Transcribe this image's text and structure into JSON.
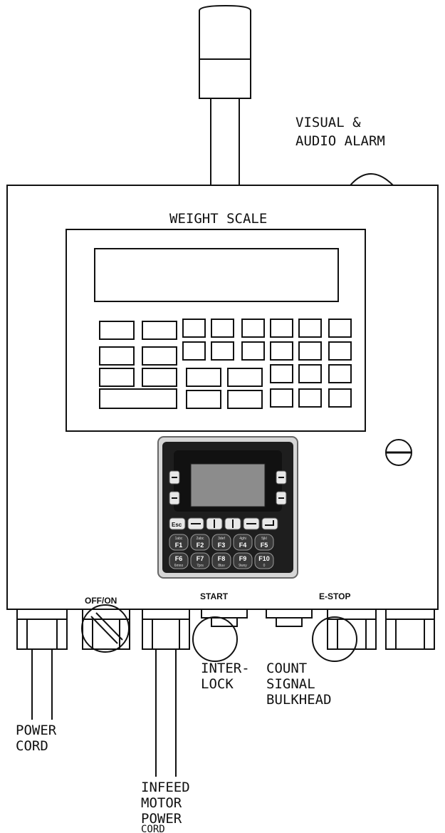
{
  "labels": {
    "alarm_line1": "VISUAL &",
    "alarm_line2": "AUDIO ALARM",
    "scale_title": "WEIGHT SCALE",
    "switch_label": "OFF/ON",
    "start_label": "START",
    "estop_label": "E-STOP",
    "interlock_line1": "INTER-",
    "interlock_line2": "LOCK",
    "count_line1": "COUNT",
    "count_line2": "SIGNAL",
    "count_line3": "BULKHEAD",
    "power_line1": "POWER",
    "power_line2": "CORD",
    "infeed_line1": "INFEED",
    "infeed_line2": "MOTOR",
    "infeed_line3": "POWER",
    "infeed_line4": "CORD"
  },
  "keypad": {
    "esc": "Esc",
    "f_keys": [
      {
        "main": "F1",
        "sub": "1abc"
      },
      {
        "main": "F2",
        "sub": "2abc"
      },
      {
        "main": "F3",
        "sub": "3def"
      },
      {
        "main": "F4",
        "sub": "4ghi"
      },
      {
        "main": "F5",
        "sub": "5jkl"
      },
      {
        "main": "F6",
        "sub": "6mno"
      },
      {
        "main": "F7",
        "sub": "7prs"
      },
      {
        "main": "F8",
        "sub": "8tuv"
      },
      {
        "main": "F9",
        "sub": "9wxy"
      },
      {
        "main": "F10",
        "sub": "0"
      }
    ]
  },
  "colors": {
    "line": "#111111",
    "panel_dark": "#1e1e1e",
    "screen": "#8c8c8c",
    "keys": "#3a3a3a"
  },
  "icons": [
    "alarm-beacon",
    "screw-icon",
    "selector-switch-icon",
    "push-button-icon",
    "cable-gland-icon"
  ]
}
